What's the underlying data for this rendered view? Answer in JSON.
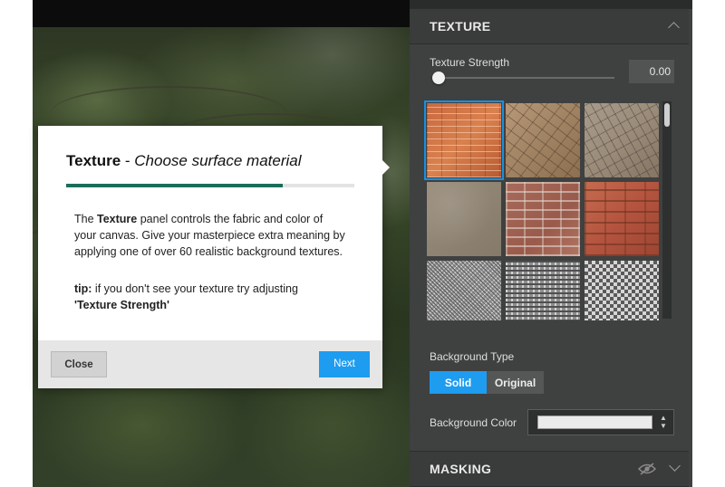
{
  "tour": {
    "title_bold": "Texture",
    "title_sep": " - ",
    "title_italic": "Choose surface material",
    "progress": 0.75,
    "body_pre": "The ",
    "body_bold": "Texture",
    "body_post": " panel controls the fabric and color of your canvas. Give your masterpiece extra meaning by applying one of over 60 realistic background textures.",
    "tip_label": "tip:",
    "tip_text": " if you don't see your texture try adjusting ",
    "tip_target": "'Texture Strength'",
    "close_label": "Close",
    "next_label": "Next"
  },
  "panel": {
    "texture_title": "TEXTURE",
    "texture_chevron": "chevron-up-icon",
    "strength_label": "Texture Strength",
    "strength_value": "0.00",
    "strength_fraction": 0.0,
    "textures": [
      {
        "name": "orange-brick",
        "selected": true,
        "color": "#c8693f"
      },
      {
        "name": "cracked-earth",
        "selected": false,
        "color": "#a08363"
      },
      {
        "name": "cracked-stone",
        "selected": false,
        "color": "#9b8c7a"
      },
      {
        "name": "plaster",
        "selected": false,
        "color": "#8f8473"
      },
      {
        "name": "brick-wall",
        "selected": false,
        "color": "#a86a5a"
      },
      {
        "name": "red-brick",
        "selected": false,
        "color": "#b4543f"
      },
      {
        "name": "bw-noise",
        "selected": false,
        "color": "#9a9a9a"
      },
      {
        "name": "bw-pattern",
        "selected": false,
        "color": "#8e8e8e"
      },
      {
        "name": "bw-checker",
        "selected": false,
        "color": "#a4a4a4"
      }
    ],
    "bg_type_label": "Background Type",
    "bg_type_options": [
      "Solid",
      "Original"
    ],
    "bg_type_selected": "Solid",
    "bg_color_label": "Background Color",
    "bg_color_value": "#ebebeb",
    "masking_title": "MASKING",
    "masking_icons": [
      "eye-hidden-icon",
      "chevron-down-icon"
    ]
  },
  "colors": {
    "accent": "#1e9cf0",
    "progress": "#1b6d5b",
    "panel_bg": "#3f4040"
  }
}
